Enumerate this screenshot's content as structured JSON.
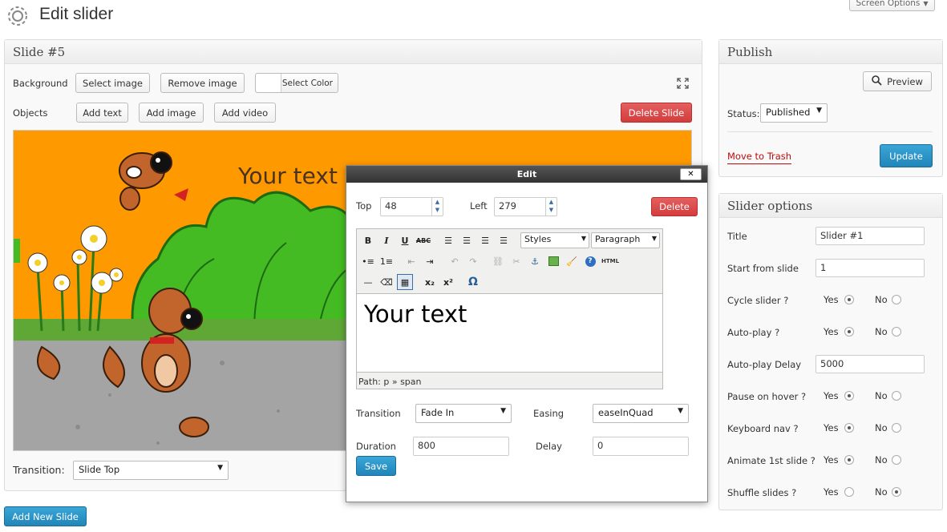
{
  "page": {
    "title": "Edit slider",
    "screen_options": "Screen Options"
  },
  "slide": {
    "heading": "Slide #5",
    "background_label": "Background",
    "select_image": "Select image",
    "remove_image": "Remove image",
    "select_color": "Select Color",
    "objects_label": "Objects",
    "add_text": "Add text",
    "add_image": "Add image",
    "add_video": "Add video",
    "delete_slide": "Delete Slide",
    "canvas_text": "Your text",
    "transition_label": "Transition:",
    "transition_value": "Slide Top",
    "add_new_slide": "Add New Slide"
  },
  "edit_dialog": {
    "title": "Edit",
    "close": "✕",
    "top_label": "Top",
    "top_value": "48",
    "left_label": "Left",
    "left_value": "279",
    "delete": "Delete",
    "styles": "Styles",
    "paragraph": "Paragraph",
    "editor_text": "Your text",
    "path": "Path: p » span",
    "transition_label": "Transition",
    "transition_value": "Fade In",
    "easing_label": "Easing",
    "easing_value": "easeInQuad",
    "duration_label": "Duration",
    "duration_value": "800",
    "delay_label": "Delay",
    "delay_value": "0",
    "save": "Save",
    "toolbar": {
      "bold": "B",
      "italic": "I",
      "underline": "U",
      "strike": "ABC",
      "html": "HTML",
      "subscript": "x₂",
      "superscript": "x²",
      "omega": "Ω"
    }
  },
  "publish": {
    "heading": "Publish",
    "preview": "Preview",
    "status_label": "Status:",
    "status_value": "Published",
    "move_to_trash": "Move to Trash",
    "update": "Update"
  },
  "options": {
    "heading": "Slider options",
    "yes": "Yes",
    "no": "No",
    "title_label": "Title",
    "title_value": "Slider #1",
    "start_label": "Start from slide",
    "start_value": "1",
    "cycle_label": "Cycle slider ?",
    "autoplay_label": "Auto-play ?",
    "delay_label": "Auto-play Delay",
    "delay_value": "5000",
    "pause_label": "Pause on hover ?",
    "keyboard_label": "Keyboard nav ?",
    "animate_label": "Animate 1st slide ?",
    "shuffle_label": "Shuffle slides ?"
  },
  "icons": [
    "gear-icon",
    "fullscreen-icon",
    "search-icon",
    "chevron-down-icon",
    "close-icon"
  ],
  "colors": {
    "slide_bg": "#ff9900",
    "delete_red": "#d33c3c",
    "update_blue": "#2185b8",
    "trash_red": "#bc0b0b"
  }
}
